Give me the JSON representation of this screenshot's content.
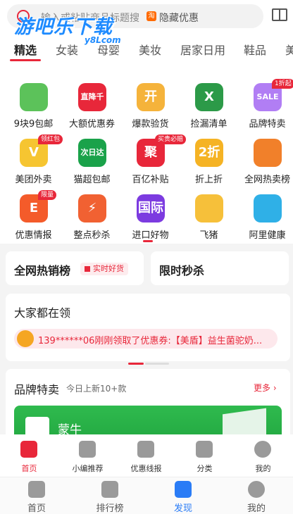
{
  "search": {
    "placeholder": "输入或粘贴商品标题搜",
    "hidden_coupon": "隐藏优惠",
    "tb_mark": "淘"
  },
  "watermark": {
    "text": "游吧乐下载",
    "sub": "y8Lcom"
  },
  "tabs": [
    "精选",
    "女装",
    "母婴",
    "美妆",
    "居家日用",
    "鞋品",
    "美"
  ],
  "grid": [
    {
      "label": "9块9包邮",
      "icon": "leaf-9-icon",
      "badge": "",
      "glyph": "",
      "color": "#5cc25a"
    },
    {
      "label": "大额优惠券",
      "icon": "big-coupon-icon",
      "badge": "",
      "glyph": "直降千元",
      "color": "#e8273a"
    },
    {
      "label": "爆款验货",
      "icon": "inspect-box-icon",
      "badge": "",
      "glyph": "开",
      "color": "#f5b33b"
    },
    {
      "label": "捡漏清单",
      "icon": "excel-list-icon",
      "badge": "",
      "glyph": "X",
      "color": "#2c9a48"
    },
    {
      "label": "品牌特卖",
      "icon": "brand-bag-icon",
      "badge": "1折起",
      "glyph": "SALE",
      "color": "#b17ef4"
    },
    {
      "label": "美团外卖",
      "icon": "kangaroo-icon",
      "badge": "领红包",
      "glyph": "V",
      "color": "#f6c531"
    },
    {
      "label": "猫超包邮",
      "icon": "tmall-cat-icon",
      "badge": "",
      "glyph": "次日达",
      "color": "#1aa24a"
    },
    {
      "label": "百亿补贴",
      "icon": "subsidy-icon",
      "badge": "买贵必赔",
      "glyph": "聚",
      "color": "#e8273a"
    },
    {
      "label": "折上折",
      "icon": "discount-icon",
      "badge": "",
      "glyph": "2折",
      "color": "#f5b324"
    },
    {
      "label": "全网热卖榜",
      "icon": "hot-chart-icon",
      "badge": "",
      "glyph": "",
      "color": "#f1802a"
    },
    {
      "label": "优惠情报",
      "icon": "news-icon",
      "badge": "限量",
      "glyph": "E",
      "color": "#f45b2a"
    },
    {
      "label": "整点秒杀",
      "icon": "alarm-icon",
      "badge": "",
      "glyph": "⚡",
      "color": "#f16132"
    },
    {
      "label": "进口好物",
      "icon": "globe-icon",
      "badge": "",
      "glyph": "国际",
      "color": "#7c3be0"
    },
    {
      "label": "飞猪",
      "icon": "fliggy-pig-icon",
      "badge": "",
      "glyph": "",
      "color": "#f6c03a"
    },
    {
      "label": "阿里健康",
      "icon": "health-icon",
      "badge": "",
      "glyph": "",
      "color": "#2fb0e7"
    }
  ],
  "cards": {
    "hot_title": "全网热销榜",
    "hot_tag": "实时好货",
    "flash_title": "限时秒杀"
  },
  "everyone": {
    "title": "大家都在领",
    "ticker": "139******06刚刚领取了优惠券:【美盾】益生菌驼奶..."
  },
  "brand": {
    "title": "品牌特卖",
    "subtitle": "今日上新10+款",
    "more": "更多",
    "banner_name": "蒙牛"
  },
  "tabbar_inner": [
    {
      "label": "首页",
      "icon": "home-icon",
      "active": true
    },
    {
      "label": "小编推荐",
      "icon": "recommend-icon",
      "active": false
    },
    {
      "label": "优惠线报",
      "icon": "deal-news-icon",
      "active": false
    },
    {
      "label": "分类",
      "icon": "category-icon",
      "active": false
    },
    {
      "label": "我的",
      "icon": "profile-icon",
      "active": false
    }
  ],
  "tabbar_outer": [
    {
      "label": "首页",
      "icon": "home-outer-icon",
      "active": false
    },
    {
      "label": "排行榜",
      "icon": "crown-icon",
      "active": false
    },
    {
      "label": "发现",
      "icon": "discover-icon",
      "active": true
    },
    {
      "label": "我的",
      "icon": "smile-icon",
      "active": false
    }
  ],
  "colors": {
    "accent": "#e8273a",
    "blue": "#2a7cf6"
  }
}
